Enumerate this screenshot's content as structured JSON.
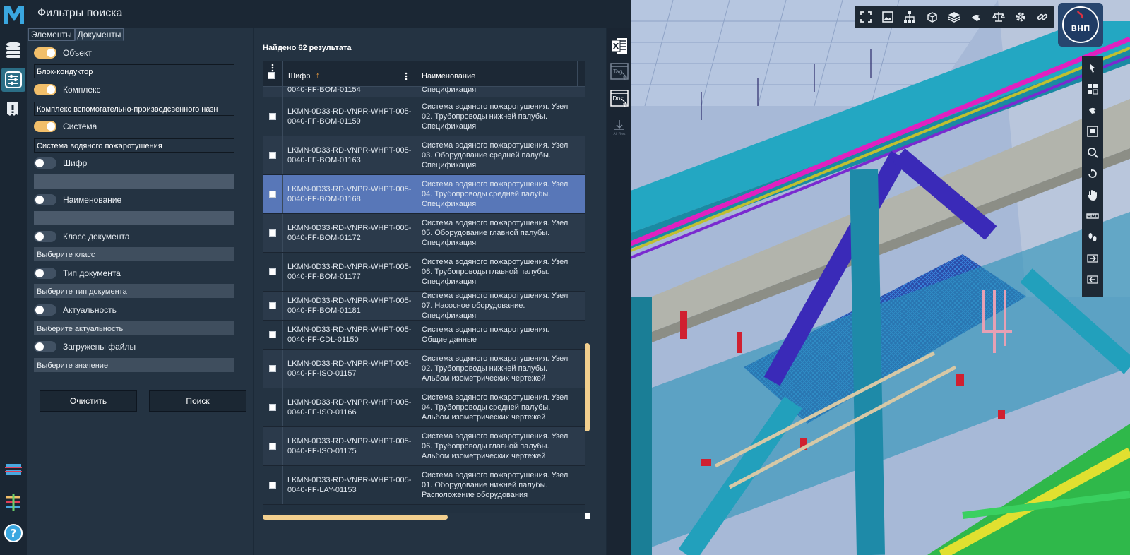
{
  "app": {
    "logo_letter": "M",
    "title": "Фильтры поиска",
    "accent": "#f2bf6a",
    "selected_row_color": "#5877b8"
  },
  "rail": {
    "icons": [
      "database-icon",
      "filter-sliders-icon",
      "alert-document-icon",
      "levels-icon",
      "structure-icon",
      "help-icon"
    ]
  },
  "tabs": [
    {
      "label": "Элементы",
      "active": false
    },
    {
      "label": "Документы",
      "active": true
    }
  ],
  "filters": [
    {
      "label": "Объект",
      "on": true,
      "value": "Блок-кондуктор",
      "placeholder": ""
    },
    {
      "label": "Комплекс",
      "on": true,
      "value": "Комплекс вспомогательно-производсвенного назн",
      "placeholder": ""
    },
    {
      "label": "Система",
      "on": true,
      "value": "Система водяного пожаротушения",
      "placeholder": ""
    },
    {
      "label": "Шифр",
      "on": false,
      "value": "",
      "placeholder": ""
    },
    {
      "label": "Наименование",
      "on": false,
      "value": "",
      "placeholder": ""
    },
    {
      "label": "Класс документа",
      "on": false,
      "value": "",
      "placeholder": "Выберите класс"
    },
    {
      "label": "Тип документа",
      "on": false,
      "value": "",
      "placeholder": "Выберите тип документа"
    },
    {
      "label": "Актуальность",
      "on": false,
      "value": "",
      "placeholder": "Выберите актуальность"
    },
    {
      "label": "Загружены файлы",
      "on": false,
      "value": "",
      "placeholder": "Выберите значение"
    }
  ],
  "buttons": {
    "clear": "Очистить",
    "search": "Поиск"
  },
  "results": {
    "count_label": "Найдено 62 результата",
    "columns": {
      "code": "Шифр",
      "name": "Наименование",
      "sort_arrow": "↑"
    },
    "rows": [
      {
        "code": "0040-FF-BOM-01154",
        "name": "Спецификация",
        "selected": false,
        "partial": true
      },
      {
        "code": "LKMN-0D33-RD-VNPR-WHPT-005-0040-FF-BOM-01159",
        "name": "Система водяного пожаротушения. Узел 02. Трубопроводы нижней палубы. Спецификация",
        "selected": false
      },
      {
        "code": "LKMN-0D33-RD-VNPR-WHPT-005-0040-FF-BOM-01163",
        "name": "Система водяного пожаротушения. Узел 03. Оборудование средней палубы. Спецификация",
        "selected": false
      },
      {
        "code": "LKMN-0D33-RD-VNPR-WHPT-005-0040-FF-BOM-01168",
        "name": "Система водяного пожаротушения. Узел 04. Трубопроводы средней палубы. Спецификация",
        "selected": true
      },
      {
        "code": "LKMN-0D33-RD-VNPR-WHPT-005-0040-FF-BOM-01172",
        "name": "Система водяного пожаротушения. Узел 05. Оборудование главной палубы. Спецификация",
        "selected": false
      },
      {
        "code": "LKMN-0D33-RD-VNPR-WHPT-005-0040-FF-BOM-01177",
        "name": "Система водяного пожаротушения. Узел 06. Трубопроводы главной палубы. Спецификация",
        "selected": false
      },
      {
        "code": "LKMN-0D33-RD-VNPR-WHPT-005-0040-FF-BOM-01181",
        "name": "Система водяного пожаротушения. Узел 07. Насосное оборудование. Спецификация",
        "selected": false
      },
      {
        "code": "LKMN-0D33-RD-VNPR-WHPT-005-0040-FF-CDL-01150",
        "name": "Система водяного пожаротушения. Общие данные",
        "selected": false
      },
      {
        "code": "LKMN-0D33-RD-VNPR-WHPT-005-0040-FF-ISO-01157",
        "name": "Система водяного пожаротушения. Узел 02. Трубопроводы нижней палубы. Альбом изометрических чертежей",
        "selected": false
      },
      {
        "code": "LKMN-0D33-RD-VNPR-WHPT-005-0040-FF-ISO-01166",
        "name": "Система водяного пожаротушения. Узел 04. Трубопроводы средней палубы. Альбом изометрических чертежей",
        "selected": false
      },
      {
        "code": "LKMN-0D33-RD-VNPR-WHPT-005-0040-FF-ISO-01175",
        "name": "Система водяного пожаротушения. Узел 06. Трубопроводы главной палубы. Альбом изометрических чертежей",
        "selected": false
      },
      {
        "code": "LKMN-0D33-RD-VNPR-WHPT-005-0040-FF-LAY-01153",
        "name": "Система водяного пожаротушения. Узел 01. Оборудование нижней палубы. Расположение оборудования",
        "selected": false
      }
    ]
  },
  "export": {
    "excel_label": "X",
    "tag_label": "Tag",
    "doc_label": "Doc",
    "all_files_label": "All Files"
  },
  "viewer": {
    "brand_label": "ВНП",
    "toolbar_icons": [
      "fullscreen-icon",
      "image-icon",
      "hierarchy-icon",
      "cube-icon",
      "layers-icon",
      "hand-pointer-icon",
      "scales-icon",
      "gear-icon",
      "link-icon"
    ],
    "side_icons": [
      "select-cursor-icon",
      "grid-view-icon",
      "cursor-arrows-icon",
      "fit-screen-icon",
      "zoom-window-icon",
      "rotate-icon",
      "pan-hand-icon",
      "measure-icon",
      "walk-icon",
      "section-in-icon",
      "section-out-icon"
    ]
  }
}
